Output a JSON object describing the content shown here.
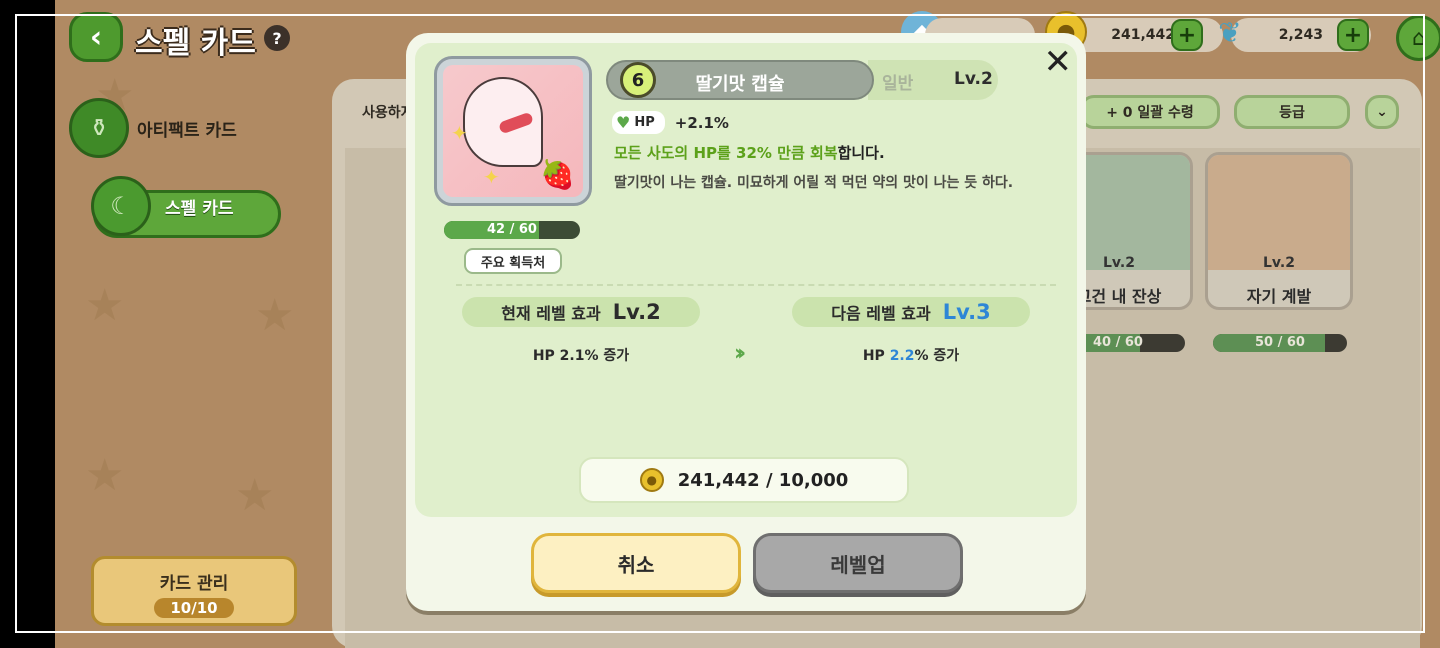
{
  "header": {
    "title": "스펠 카드",
    "help": "?"
  },
  "resources": {
    "gold": "241,442",
    "leaf": "2,243"
  },
  "sidebar": {
    "items": [
      {
        "label": "아티팩트 카드"
      },
      {
        "label": "스펠 카드"
      }
    ]
  },
  "card_manage": {
    "label": "카드 관리",
    "count": "10/10"
  },
  "filters": {
    "left_label": "사용하지",
    "bulk": "+ 0  일괄 수령",
    "grade": "등급"
  },
  "bg_cards": [
    {
      "level": "Lv.2",
      "name": "고건 내 잔상",
      "progress": "40 / 60",
      "progress_fraction": 0.667
    },
    {
      "level": "Lv.2",
      "name": "자기 계발",
      "progress": "50 / 60",
      "progress_fraction": 0.833
    }
  ],
  "modal": {
    "close": "✕",
    "cost_badge": "6",
    "card_name": "딸기맛 캡슐",
    "rarity": "일반",
    "level": "Lv.2",
    "stat_label": "HP",
    "stat_value": "+2.1%",
    "desc_highlight": "모든 사도의 HP를 32% 만큼 회복",
    "desc_tail": "합니다.",
    "flavor": "딸기맛이 나는 캡슐. 미묘하게 어릴 적 먹던 약의 맛이 나는 듯 하다.",
    "progress": "42 / 60",
    "progress_fraction": 0.7,
    "source_button": "주요 획득처",
    "current": {
      "label": "현재 레벨 효과",
      "level": "Lv.2",
      "effect": "HP 2.1% 증가"
    },
    "next": {
      "label": "다음 레벨 효과",
      "level": "Lv.3",
      "effect_prefix": "HP ",
      "effect_value": "2.2",
      "effect_suffix": "% 증가"
    },
    "cost": "241,442 / 10,000",
    "cancel": "취소",
    "levelup": "레벨업"
  },
  "colors": {
    "accent_green": "#5ca84a",
    "next_level_blue": "#2e86d6",
    "cancel_yellow": "#fdf0c2",
    "disabled_gray": "#a8a8a8"
  }
}
